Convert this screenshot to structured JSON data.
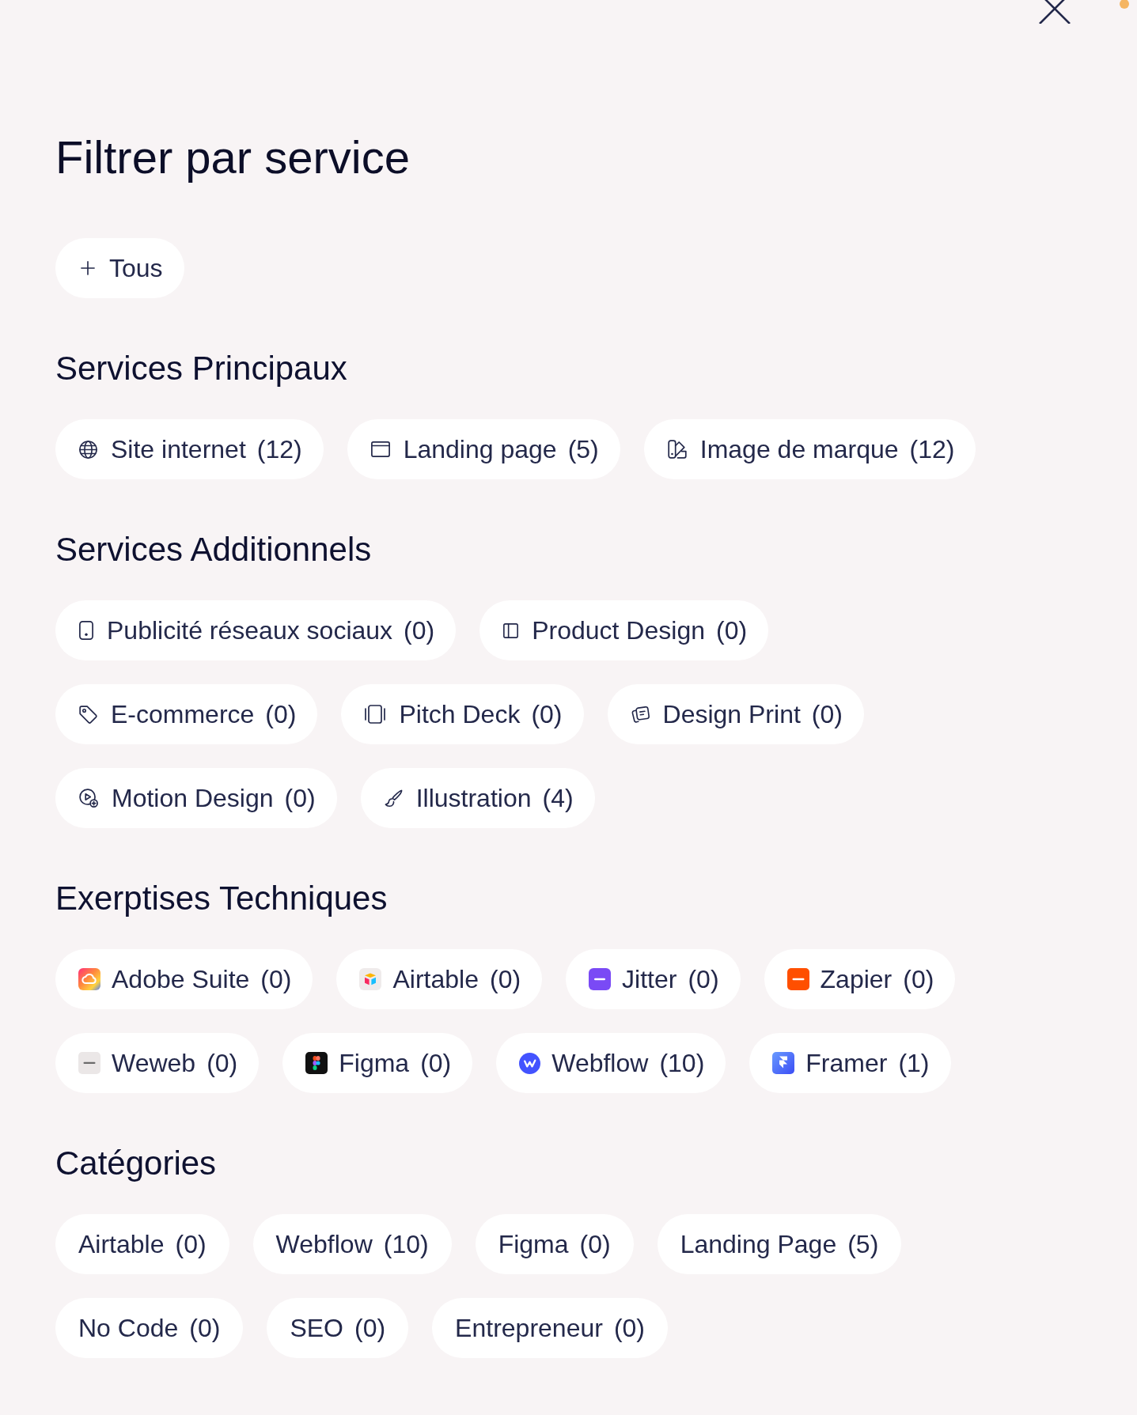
{
  "title": "Filtrer par service",
  "all_button": {
    "label": "Tous",
    "selected": false
  },
  "sections": [
    {
      "heading": "Services Principaux",
      "chips": [
        {
          "label": "Site internet",
          "count": "(12)",
          "selected": false
        },
        {
          "label": "Landing page",
          "count": "(5)",
          "selected": false
        },
        {
          "label": "Image de marque",
          "count": "(12)",
          "selected": false
        }
      ]
    },
    {
      "heading": "Services Additionnels",
      "chips": [
        {
          "label": "Publicité réseaux sociaux",
          "count": "(0)",
          "selected": false
        },
        {
          "label": "Product Design",
          "count": "(0)",
          "selected": false
        },
        {
          "label": "E-commerce",
          "count": "(0)",
          "selected": false
        },
        {
          "label": "Pitch Deck",
          "count": "(0)",
          "selected": false
        },
        {
          "label": "Design Print",
          "count": "(0)",
          "selected": false
        },
        {
          "label": "Motion Design",
          "count": "(0)",
          "selected": false
        },
        {
          "label": "Illustration",
          "count": "(4)",
          "selected": false
        }
      ]
    },
    {
      "heading": "Exerptises Techniques",
      "chips": [
        {
          "label": "Adobe Suite",
          "count": "(0)",
          "selected": false
        },
        {
          "label": "Airtable",
          "count": "(0)",
          "selected": false
        },
        {
          "label": "Jitter",
          "count": "(0)",
          "selected": false
        },
        {
          "label": "Zapier",
          "count": "(0)",
          "selected": false
        },
        {
          "label": "Weweb",
          "count": "(0)",
          "selected": false
        },
        {
          "label": "Figma",
          "count": "(0)",
          "selected": false
        },
        {
          "label": "Webflow",
          "count": "(10)",
          "selected": false
        },
        {
          "label": "Framer",
          "count": "(1)",
          "selected": false
        }
      ]
    },
    {
      "heading": "Catégories",
      "chips": [
        {
          "label": "Airtable",
          "count": "(0)",
          "selected": false
        },
        {
          "label": "Webflow",
          "count": "(10)",
          "selected": false
        },
        {
          "label": "Figma",
          "count": "(0)",
          "selected": false
        },
        {
          "label": "Landing Page",
          "count": "(5)",
          "selected": false
        },
        {
          "label": "No Code",
          "count": "(0)",
          "selected": false
        },
        {
          "label": "SEO",
          "count": "(0)",
          "selected": false
        },
        {
          "label": "Entrepreneur",
          "count": "(0)",
          "selected": false
        }
      ]
    }
  ]
}
